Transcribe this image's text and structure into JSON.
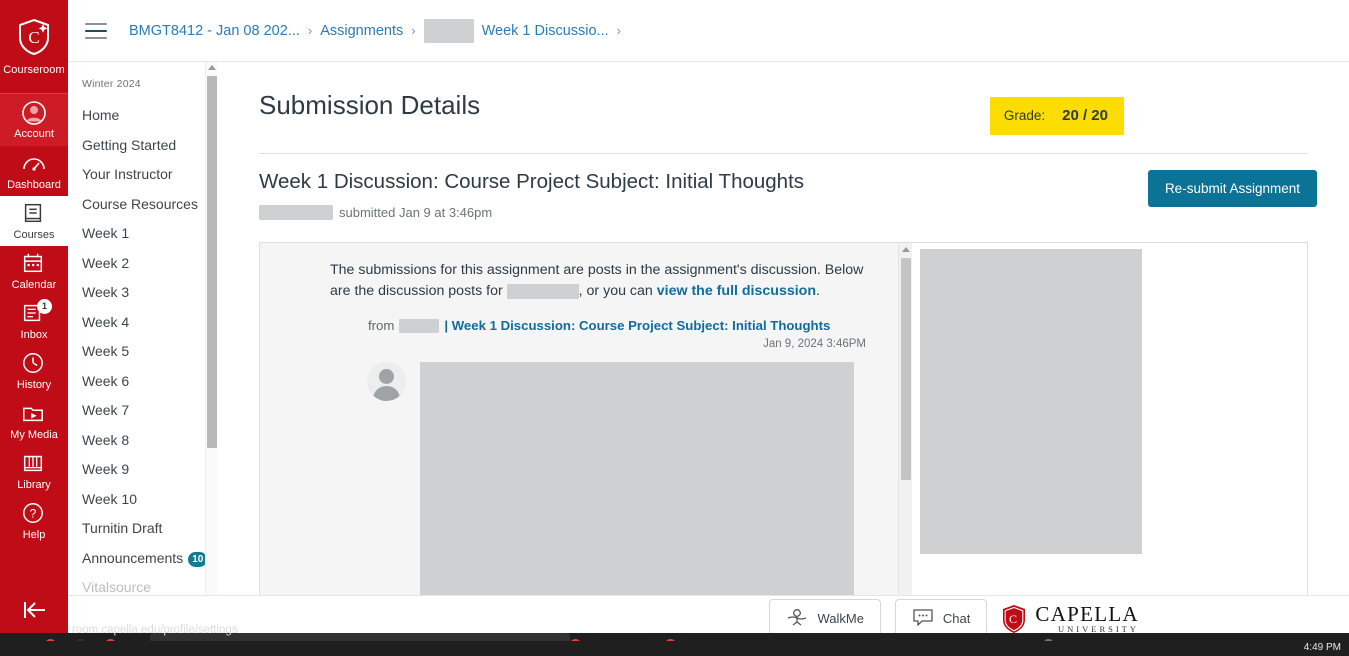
{
  "global_nav": {
    "brand": {
      "label": "Courseroom",
      "icon": "capella-shield-icon"
    },
    "items": [
      {
        "label": "Account",
        "icon": "account-icon",
        "state": "dim-active"
      },
      {
        "label": "Dashboard",
        "icon": "dashboard-gauge-icon",
        "state": "normal"
      },
      {
        "label": "Courses",
        "icon": "courses-book-icon",
        "state": "active"
      },
      {
        "label": "Calendar",
        "icon": "calendar-icon",
        "state": "normal"
      },
      {
        "label": "Inbox",
        "icon": "inbox-icon",
        "state": "normal",
        "badge": "1"
      },
      {
        "label": "History",
        "icon": "history-clock-icon",
        "state": "normal"
      },
      {
        "label": "My Media",
        "icon": "my-media-play-icon",
        "state": "normal"
      },
      {
        "label": "Library",
        "icon": "library-books-icon",
        "state": "normal"
      },
      {
        "label": "Help",
        "icon": "help-question-icon",
        "state": "normal"
      }
    ],
    "collapse": {
      "icon": "collapse-left-arrow-icon"
    }
  },
  "topbar": {
    "menu_icon": "hamburger-menu-icon",
    "breadcrumb": [
      {
        "label": "BMGT8412 - Jan 08 202...",
        "type": "link"
      },
      {
        "label": "Assignments",
        "type": "link"
      },
      {
        "label": "Week 1 Discussio...",
        "type": "link",
        "redacted_prefix": true
      }
    ],
    "separator": "›"
  },
  "course_nav": {
    "term": "Winter 2024",
    "items": [
      {
        "label": "Home"
      },
      {
        "label": "Getting Started"
      },
      {
        "label": "Your Instructor"
      },
      {
        "label": "Course Resources"
      },
      {
        "label": "Week 1"
      },
      {
        "label": "Week 2"
      },
      {
        "label": "Week 3"
      },
      {
        "label": "Week 4"
      },
      {
        "label": "Week 5"
      },
      {
        "label": "Week 6"
      },
      {
        "label": "Week 7"
      },
      {
        "label": "Week 8"
      },
      {
        "label": "Week 9"
      },
      {
        "label": "Week 10"
      },
      {
        "label": "Turnitin Draft"
      },
      {
        "label": "Announcements",
        "badge": "10"
      },
      {
        "label": "Vitalsource",
        "clipped": true
      }
    ]
  },
  "main": {
    "page_title": "Submission Details",
    "grade": {
      "label": "Grade:",
      "value": "20 / 20"
    },
    "assignment": {
      "title": "Week 1 Discussion: Course Project Subject: Initial Thoughts",
      "submitted_text": "submitted Jan 9 at 3:46pm",
      "resubmit_label": "Re-submit Assignment"
    },
    "submission": {
      "intro_part1": "The submissions for this assignment are posts in the assignment's discussion. Below are the discussion posts for",
      "intro_part2": ", or you can",
      "intro_link": "view the full discussion",
      "intro_end": ".",
      "from_label": "from",
      "post_title": "| Week 1 Discussion: Course Project Subject: Initial Thoughts",
      "post_date": "Jan 9, 2024 3:46PM"
    }
  },
  "footer": {
    "walkme_label": "WalkMe",
    "walkme_icon": "walkme-icon",
    "chat_label": "Chat",
    "chat_icon": "chat-bubble-icon",
    "logo_name": "CAPELLA",
    "logo_sub": "UNIVERSITY"
  },
  "status_bar": {
    "url": "room.capella.edu/profile/settings"
  },
  "taskbar": {
    "clock": "4:49 PM"
  },
  "colors": {
    "brand_red": "#c00c17",
    "accent_blue": "#0a7396",
    "link_blue": "#2b7bb9",
    "grade_yellow": "#fbdd02",
    "badge_teal": "#127a91"
  }
}
